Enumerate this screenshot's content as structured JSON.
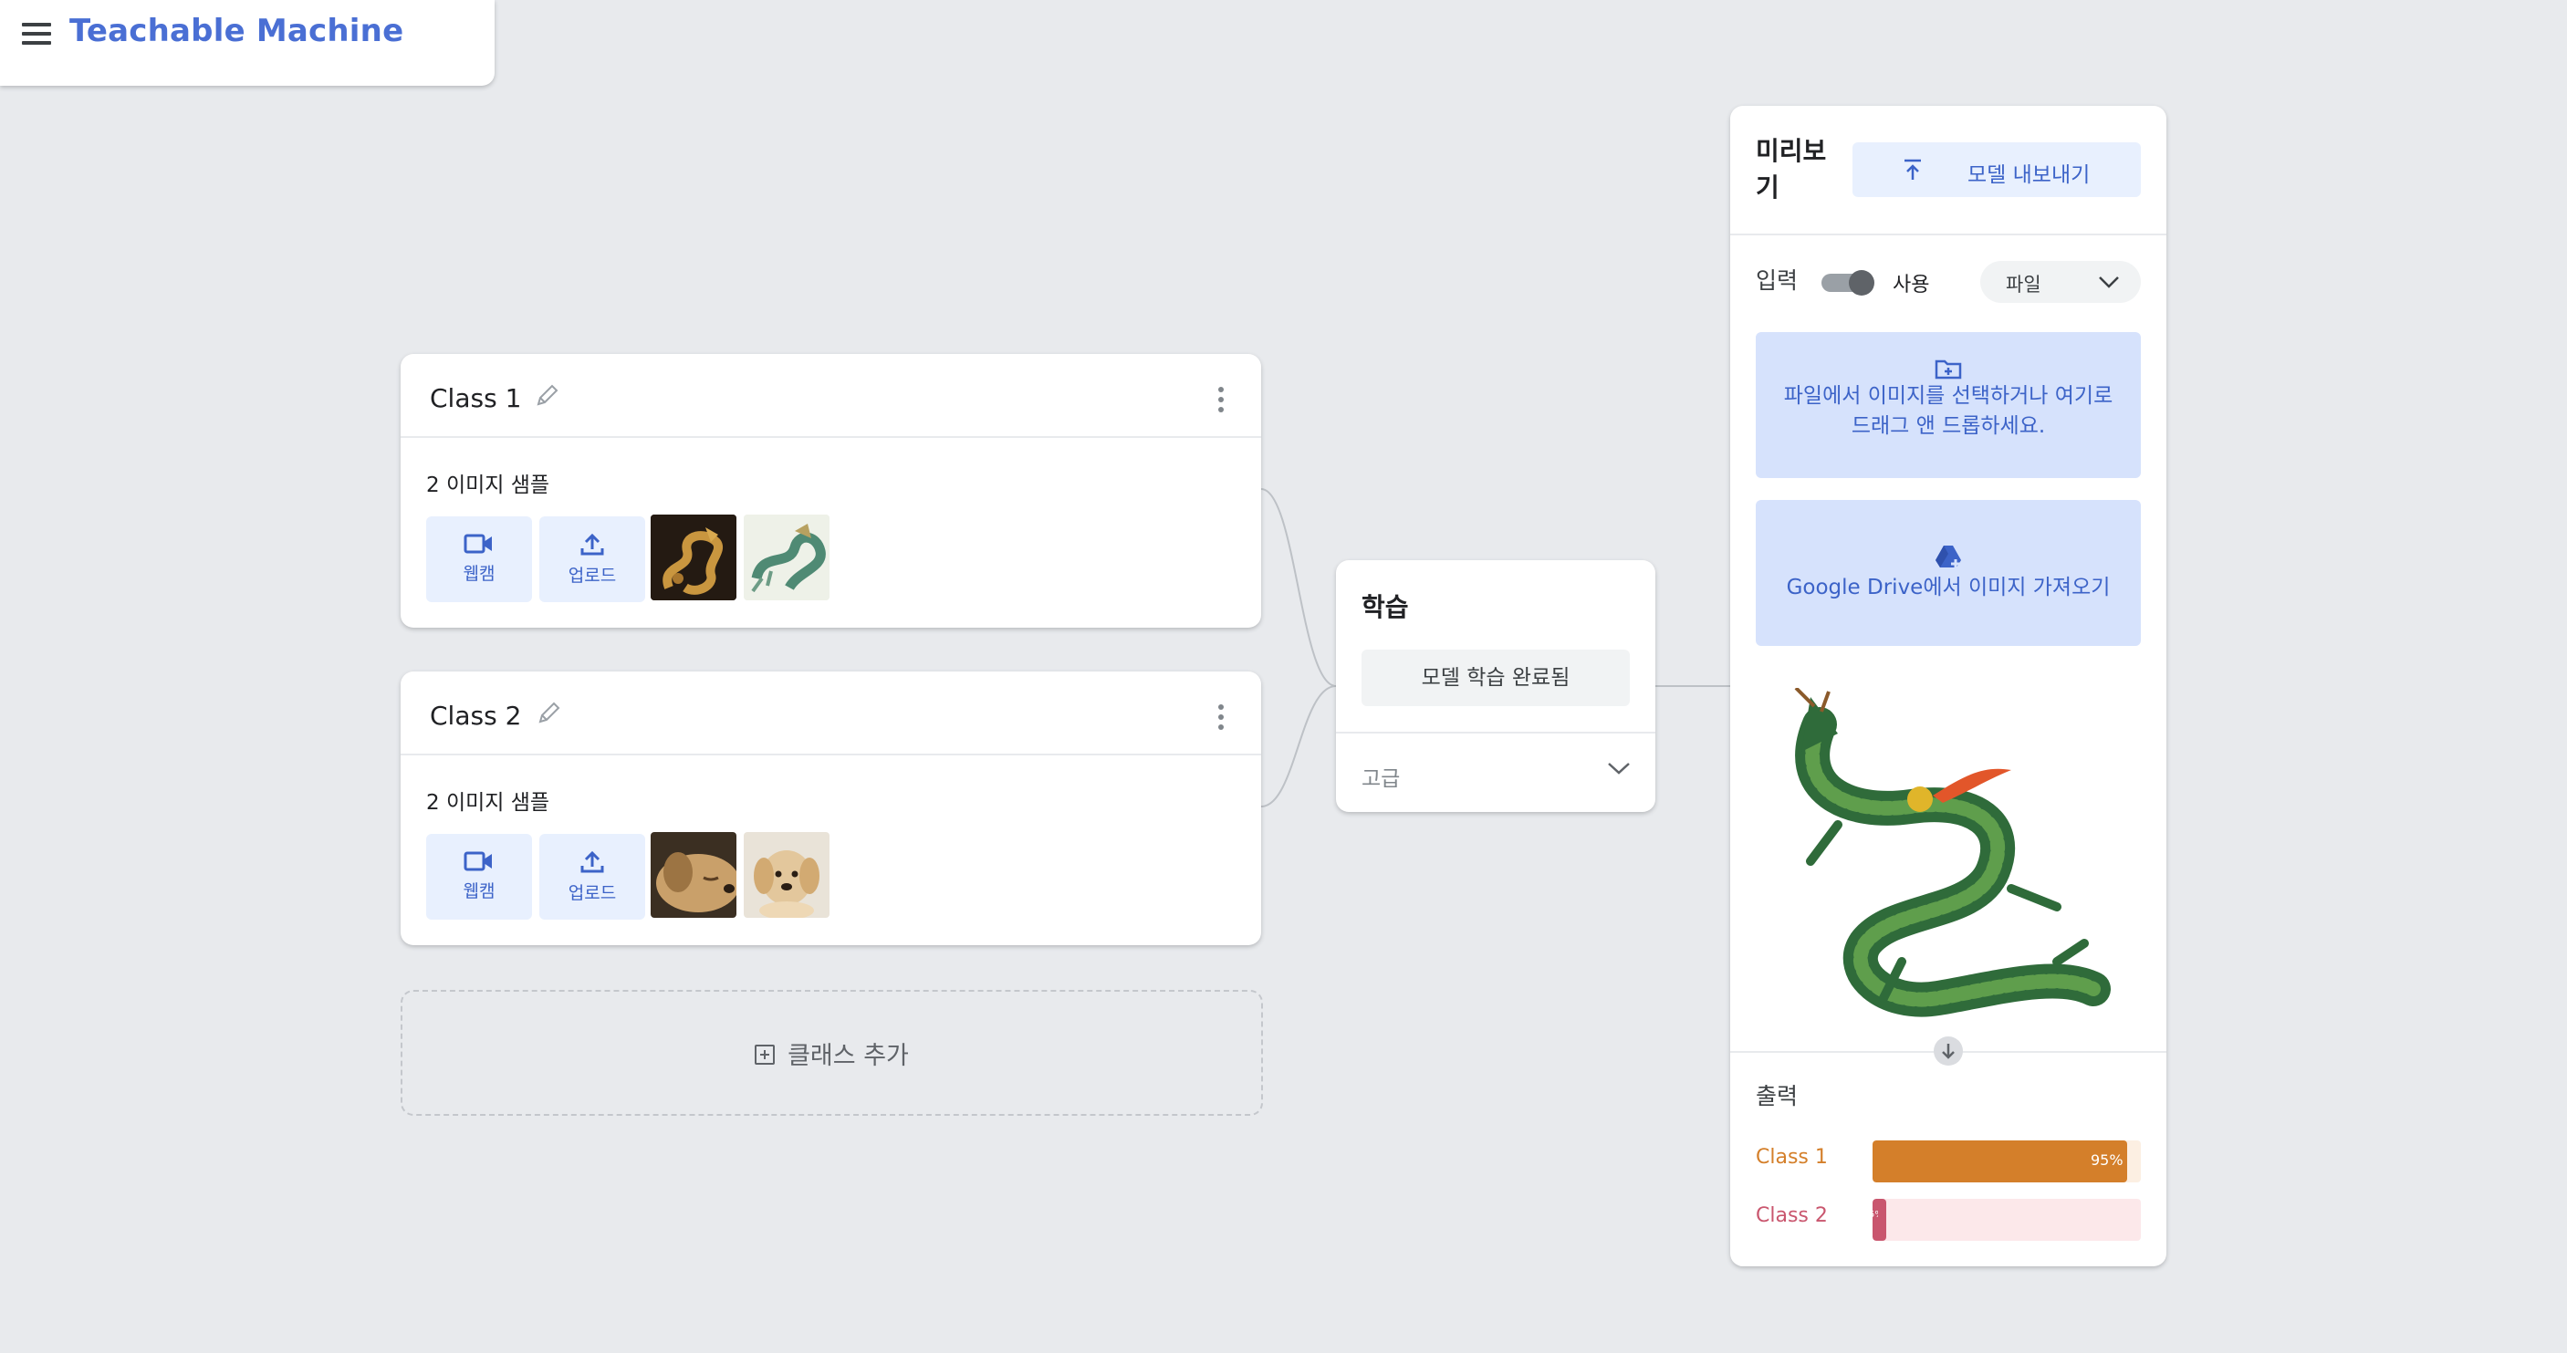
{
  "app": {
    "title": "Teachable Machine"
  },
  "classes": [
    {
      "name": "Class 1",
      "samples_label": "2 이미지 샘플",
      "webcam_label": "웹캠",
      "upload_label": "업로드",
      "thumbnails": [
        "golden-dragon-image",
        "jade-dragon-image"
      ]
    },
    {
      "name": "Class 2",
      "samples_label": "2 이미지 샘플",
      "webcam_label": "웹캠",
      "upload_label": "업로드",
      "thumbnails": [
        "dog-sleeping-image",
        "puppy-image"
      ]
    }
  ],
  "add_class_label": "클래스 추가",
  "training": {
    "title": "학습",
    "button_label": "모델 학습 완료됨",
    "advanced_label": "고급"
  },
  "preview": {
    "title": "미리보기",
    "export_label": "모델 내보내기",
    "input_label": "입력",
    "toggle_label": "사용",
    "toggle_on": true,
    "source_value": "파일",
    "file_drop_text": "파일에서 이미지를 선택하거나 여기로 드래그 앤 드롭하세요.",
    "drive_text": "Google Drive에서 이미지 가져오기",
    "output_label": "출력",
    "outputs": [
      {
        "name": "Class 1",
        "percent": 95,
        "percent_label": "95%",
        "color": "#d47f2a",
        "track": "#fcefe2"
      },
      {
        "name": "Class 2",
        "percent": 5,
        "percent_label": "5%",
        "color": "#c9566e",
        "track": "#fce8ea"
      }
    ]
  },
  "colors": {
    "accent": "#4a6fd4",
    "canvas": "#e8eaed",
    "button_bg": "#e8f0fe",
    "drop_bg": "#d6e2fc"
  }
}
